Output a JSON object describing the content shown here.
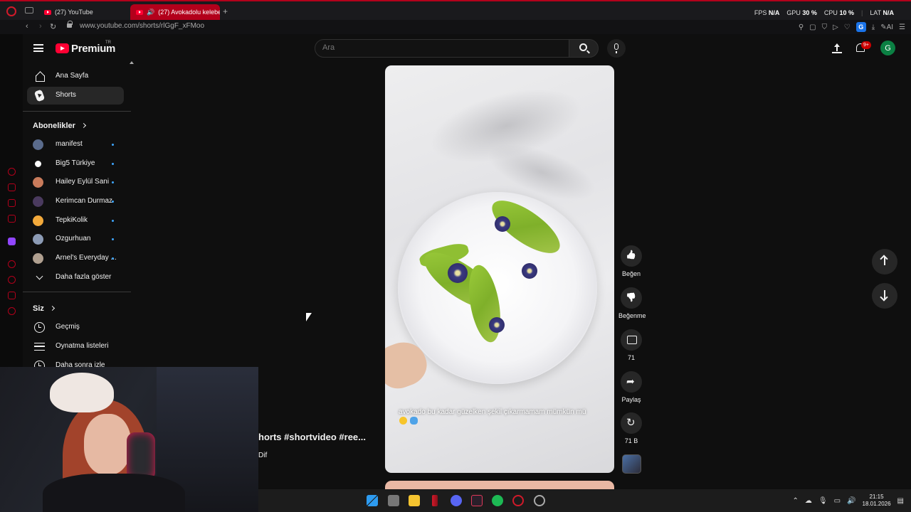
{
  "browser": {
    "tabs": [
      {
        "title": "(27) YouTube"
      },
      {
        "title": "(27) Avokadolu kelebek"
      }
    ],
    "url": "www.youtube.com/shorts/rlGgF_xFMoo",
    "profile_initial": "G",
    "ai_label": "AI",
    "stats": {
      "fps_label": "FPS",
      "fps_value": "N/A",
      "gpu_label": "GPU",
      "gpu_value": "30 %",
      "cpu_label": "CPU",
      "cpu_value": "10 %",
      "lat_label": "LAT",
      "lat_value": "N/A"
    }
  },
  "header": {
    "logo_text": "Premium",
    "logo_region": "TR",
    "search_placeholder": "Ara",
    "notification_count": "9+",
    "avatar_initial": "G"
  },
  "guide": {
    "home_label": "Ana Sayfa",
    "shorts_label": "Shorts",
    "subscriptions_title": "Abonelikler",
    "subscriptions": [
      {
        "name": "manifest",
        "color": "#5a6b8c"
      },
      {
        "name": "Big5 Türkiye",
        "color": "#ffffff"
      },
      {
        "name": "Hailey Eylül Sani",
        "color": "#c97b5b"
      },
      {
        "name": "Kerimcan Durmaz",
        "color": "#4a3a5e"
      },
      {
        "name": "TepkiKolik",
        "color": "#f2a93b"
      },
      {
        "name": "Ozgurhuan",
        "color": "#8c9bb5"
      },
      {
        "name": "Arnel's Everyday ...",
        "color": "#b0a090"
      }
    ],
    "show_more_label": "Daha fazla göster",
    "you_title": "Siz",
    "history_label": "Geçmiş",
    "playlists_label": "Oynatma listeleri",
    "watch_later_label": "Daha sonra izle"
  },
  "short": {
    "caption": "avokado bu kadar güzelken şekil çıkarmamam mümkün mü",
    "like_label": "Beğen",
    "dislike_label": "Beğenme",
    "comment_count": "71",
    "share_label": "Paylaş",
    "remix_count": "71 B",
    "behind_title": "horts #shortvideo #ree...",
    "behind_channel": "Dif",
    "behind_mark": "I"
  },
  "taskbar": {
    "time": "21:15",
    "date": "18.01.2026"
  }
}
